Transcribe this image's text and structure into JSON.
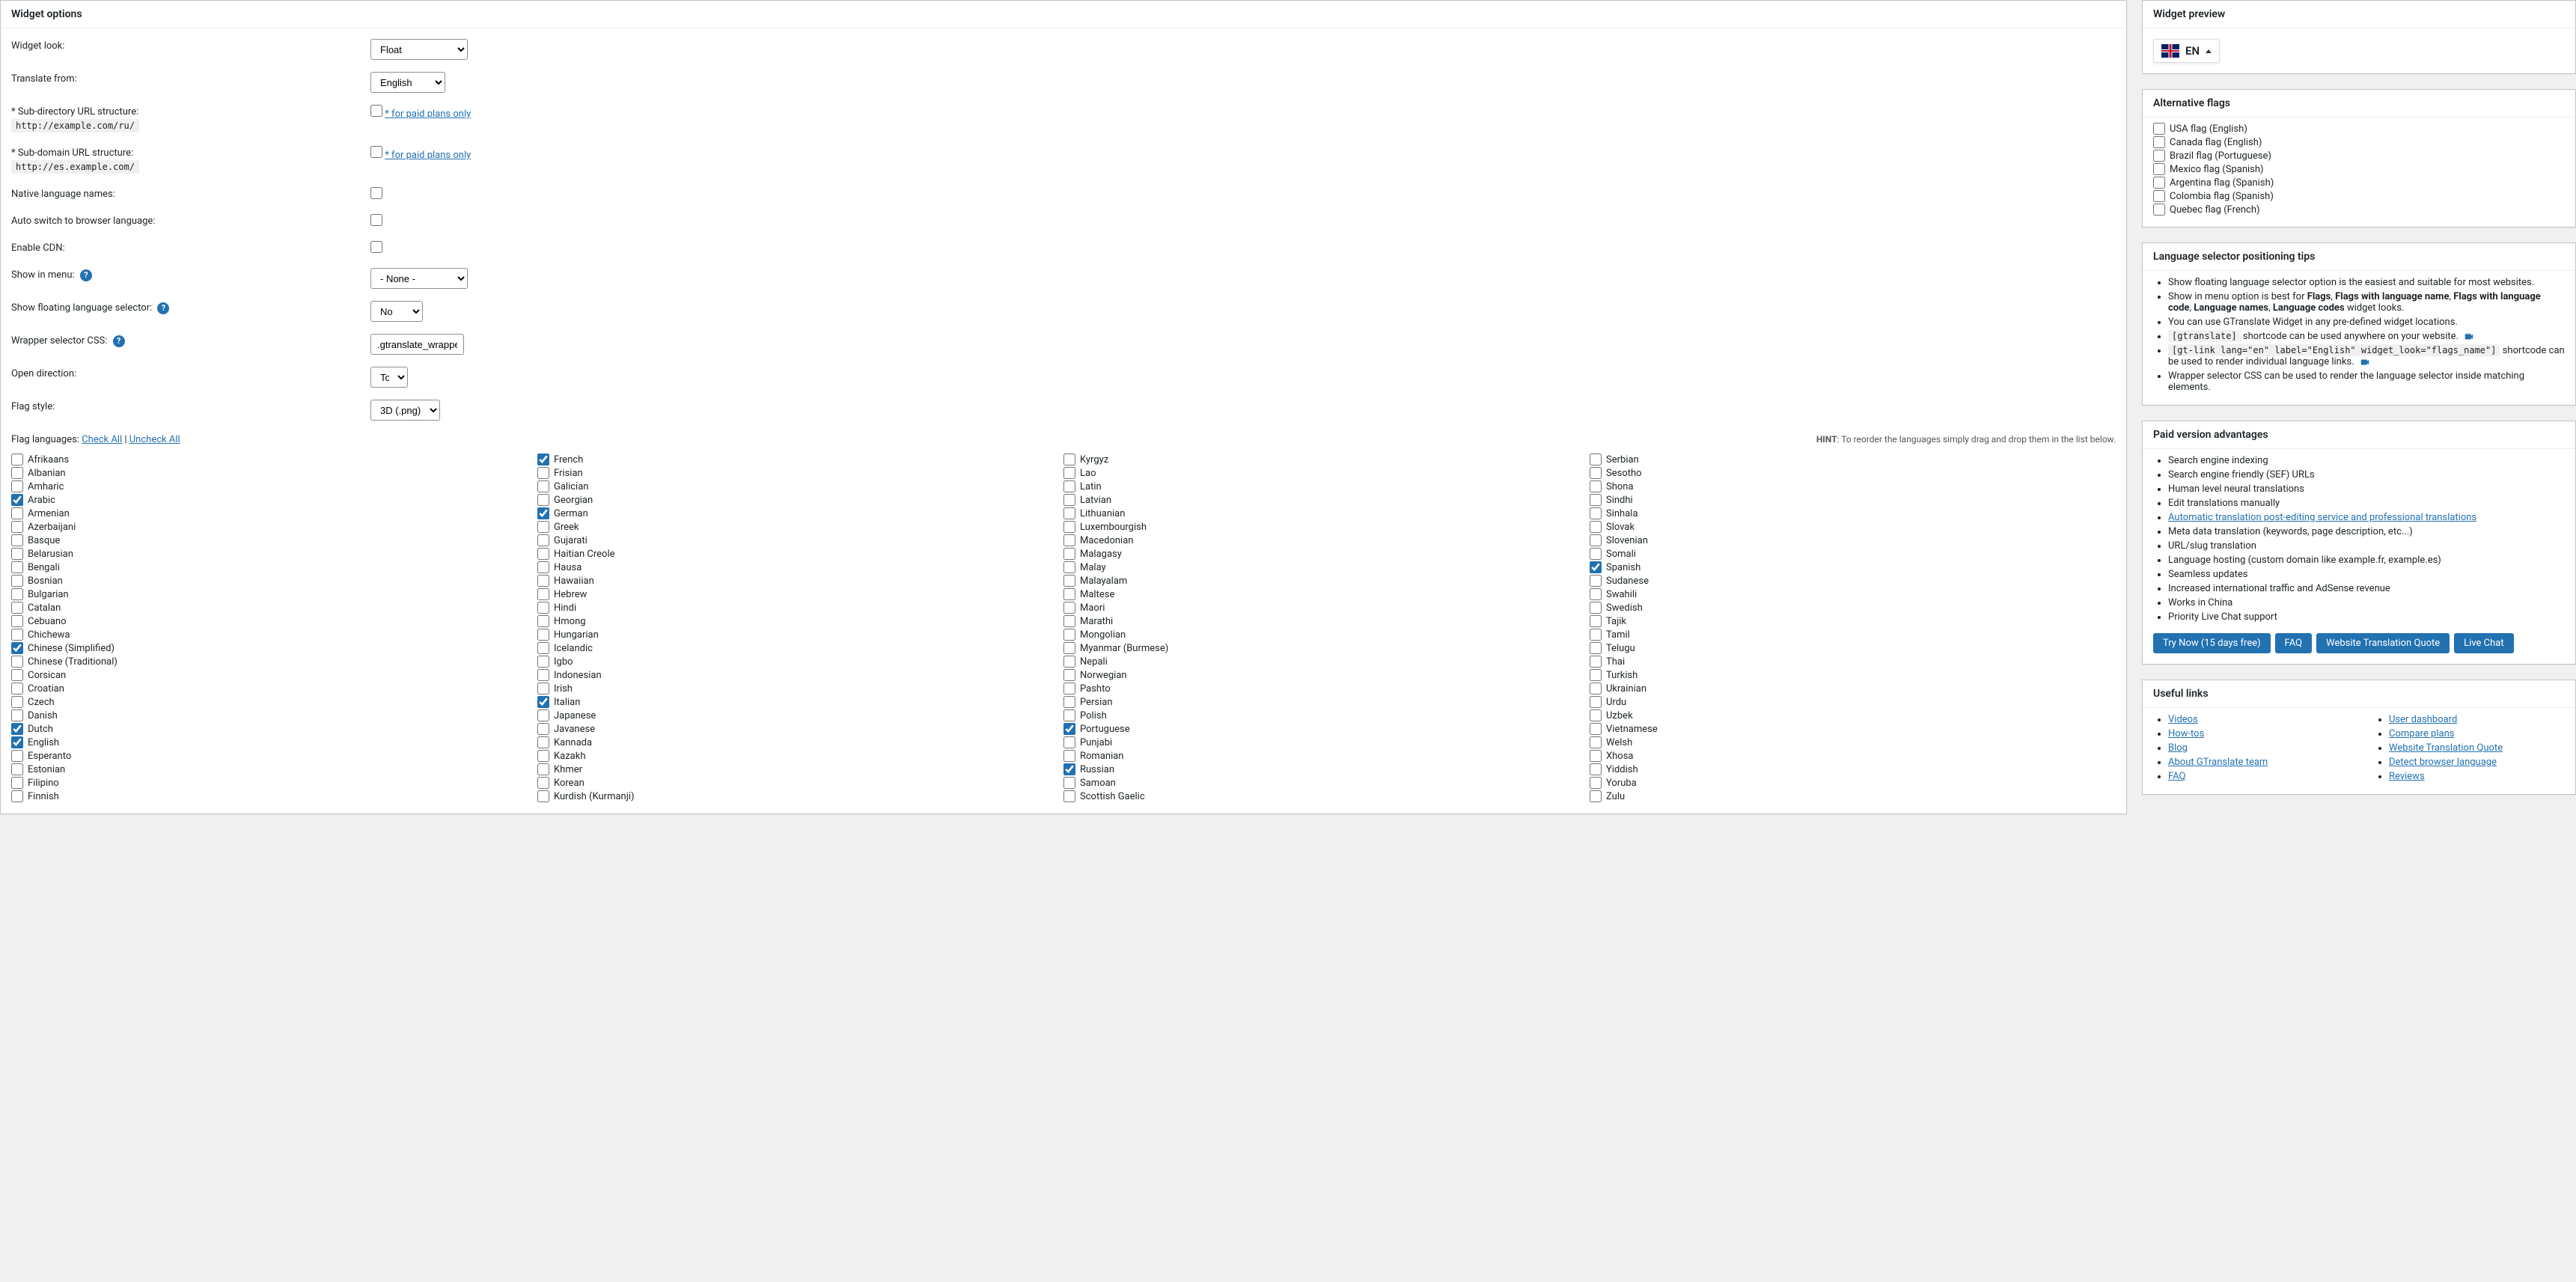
{
  "widgetOptions": {
    "title": "Widget options",
    "rows": {
      "widgetLook": {
        "label": "Widget look:",
        "value": "Float"
      },
      "translateFrom": {
        "label": "Translate from:",
        "value": "English"
      },
      "subDirUrl": {
        "label": "* Sub-directory URL structure:",
        "example": "http://example.com/ru/",
        "paidLink": "* for paid plans only"
      },
      "subDomainUrl": {
        "label": "* Sub-domain URL structure:",
        "example": "http://es.example.com/",
        "paidLink": "* for paid plans only"
      },
      "nativeNames": {
        "label": "Native language names:"
      },
      "autoSwitch": {
        "label": "Auto switch to browser language:"
      },
      "enableCdn": {
        "label": "Enable CDN:"
      },
      "showInMenu": {
        "label": "Show in menu:",
        "value": "- None -"
      },
      "showFloating": {
        "label": "Show floating language selector:",
        "value": "No"
      },
      "wrapperCss": {
        "label": "Wrapper selector CSS:",
        "value": ".gtranslate_wrapper"
      },
      "openDirection": {
        "label": "Open direction:",
        "value": "Top"
      },
      "flagStyle": {
        "label": "Flag style:",
        "value": "3D (.png)"
      }
    },
    "flagLanguagesLabel": "Flag languages:",
    "checkAll": "Check All",
    "uncheckAll": "Uncheck All",
    "hint": {
      "prefix": "HINT",
      "text": ": To reorder the languages simply drag and drop them in the list below."
    },
    "languages": [
      [
        {
          "name": "Afrikaans",
          "checked": false
        },
        {
          "name": "Albanian",
          "checked": false
        },
        {
          "name": "Amharic",
          "checked": false
        },
        {
          "name": "Arabic",
          "checked": true
        },
        {
          "name": "Armenian",
          "checked": false
        },
        {
          "name": "Azerbaijani",
          "checked": false
        },
        {
          "name": "Basque",
          "checked": false
        },
        {
          "name": "Belarusian",
          "checked": false
        },
        {
          "name": "Bengali",
          "checked": false
        },
        {
          "name": "Bosnian",
          "checked": false
        },
        {
          "name": "Bulgarian",
          "checked": false
        },
        {
          "name": "Catalan",
          "checked": false
        },
        {
          "name": "Cebuano",
          "checked": false
        },
        {
          "name": "Chichewa",
          "checked": false
        },
        {
          "name": "Chinese (Simplified)",
          "checked": true
        },
        {
          "name": "Chinese (Traditional)",
          "checked": false
        },
        {
          "name": "Corsican",
          "checked": false
        },
        {
          "name": "Croatian",
          "checked": false
        },
        {
          "name": "Czech",
          "checked": false
        },
        {
          "name": "Danish",
          "checked": false
        },
        {
          "name": "Dutch",
          "checked": true
        },
        {
          "name": "English",
          "checked": true
        },
        {
          "name": "Esperanto",
          "checked": false
        },
        {
          "name": "Estonian",
          "checked": false
        },
        {
          "name": "Filipino",
          "checked": false
        },
        {
          "name": "Finnish",
          "checked": false
        }
      ],
      [
        {
          "name": "French",
          "checked": true
        },
        {
          "name": "Frisian",
          "checked": false
        },
        {
          "name": "Galician",
          "checked": false
        },
        {
          "name": "Georgian",
          "checked": false
        },
        {
          "name": "German",
          "checked": true
        },
        {
          "name": "Greek",
          "checked": false
        },
        {
          "name": "Gujarati",
          "checked": false
        },
        {
          "name": "Haitian Creole",
          "checked": false
        },
        {
          "name": "Hausa",
          "checked": false
        },
        {
          "name": "Hawaiian",
          "checked": false
        },
        {
          "name": "Hebrew",
          "checked": false
        },
        {
          "name": "Hindi",
          "checked": false
        },
        {
          "name": "Hmong",
          "checked": false
        },
        {
          "name": "Hungarian",
          "checked": false
        },
        {
          "name": "Icelandic",
          "checked": false
        },
        {
          "name": "Igbo",
          "checked": false
        },
        {
          "name": "Indonesian",
          "checked": false
        },
        {
          "name": "Irish",
          "checked": false
        },
        {
          "name": "Italian",
          "checked": true
        },
        {
          "name": "Japanese",
          "checked": false
        },
        {
          "name": "Javanese",
          "checked": false
        },
        {
          "name": "Kannada",
          "checked": false
        },
        {
          "name": "Kazakh",
          "checked": false
        },
        {
          "name": "Khmer",
          "checked": false
        },
        {
          "name": "Korean",
          "checked": false
        },
        {
          "name": "Kurdish (Kurmanji)",
          "checked": false
        }
      ],
      [
        {
          "name": "Kyrgyz",
          "checked": false
        },
        {
          "name": "Lao",
          "checked": false
        },
        {
          "name": "Latin",
          "checked": false
        },
        {
          "name": "Latvian",
          "checked": false
        },
        {
          "name": "Lithuanian",
          "checked": false
        },
        {
          "name": "Luxembourgish",
          "checked": false
        },
        {
          "name": "Macedonian",
          "checked": false
        },
        {
          "name": "Malagasy",
          "checked": false
        },
        {
          "name": "Malay",
          "checked": false
        },
        {
          "name": "Malayalam",
          "checked": false
        },
        {
          "name": "Maltese",
          "checked": false
        },
        {
          "name": "Maori",
          "checked": false
        },
        {
          "name": "Marathi",
          "checked": false
        },
        {
          "name": "Mongolian",
          "checked": false
        },
        {
          "name": "Myanmar (Burmese)",
          "checked": false
        },
        {
          "name": "Nepali",
          "checked": false
        },
        {
          "name": "Norwegian",
          "checked": false
        },
        {
          "name": "Pashto",
          "checked": false
        },
        {
          "name": "Persian",
          "checked": false
        },
        {
          "name": "Polish",
          "checked": false
        },
        {
          "name": "Portuguese",
          "checked": true
        },
        {
          "name": "Punjabi",
          "checked": false
        },
        {
          "name": "Romanian",
          "checked": false
        },
        {
          "name": "Russian",
          "checked": true
        },
        {
          "name": "Samoan",
          "checked": false
        },
        {
          "name": "Scottish Gaelic",
          "checked": false
        }
      ],
      [
        {
          "name": "Serbian",
          "checked": false
        },
        {
          "name": "Sesotho",
          "checked": false
        },
        {
          "name": "Shona",
          "checked": false
        },
        {
          "name": "Sindhi",
          "checked": false
        },
        {
          "name": "Sinhala",
          "checked": false
        },
        {
          "name": "Slovak",
          "checked": false
        },
        {
          "name": "Slovenian",
          "checked": false
        },
        {
          "name": "Somali",
          "checked": false
        },
        {
          "name": "Spanish",
          "checked": true
        },
        {
          "name": "Sudanese",
          "checked": false
        },
        {
          "name": "Swahili",
          "checked": false
        },
        {
          "name": "Swedish",
          "checked": false
        },
        {
          "name": "Tajik",
          "checked": false
        },
        {
          "name": "Tamil",
          "checked": false
        },
        {
          "name": "Telugu",
          "checked": false
        },
        {
          "name": "Thai",
          "checked": false
        },
        {
          "name": "Turkish",
          "checked": false
        },
        {
          "name": "Ukrainian",
          "checked": false
        },
        {
          "name": "Urdu",
          "checked": false
        },
        {
          "name": "Uzbek",
          "checked": false
        },
        {
          "name": "Vietnamese",
          "checked": false
        },
        {
          "name": "Welsh",
          "checked": false
        },
        {
          "name": "Xhosa",
          "checked": false
        },
        {
          "name": "Yiddish",
          "checked": false
        },
        {
          "name": "Yoruba",
          "checked": false
        },
        {
          "name": "Zulu",
          "checked": false
        }
      ]
    ]
  },
  "widgetPreview": {
    "title": "Widget preview",
    "code": "EN"
  },
  "altFlags": {
    "title": "Alternative flags",
    "items": [
      "USA flag (English)",
      "Canada flag (English)",
      "Brazil flag (Portuguese)",
      "Mexico flag (Spanish)",
      "Argentina flag (Spanish)",
      "Colombia flag (Spanish)",
      "Quebec flag (French)"
    ]
  },
  "tips": {
    "title": "Language selector positioning tips",
    "li1": "Show floating language selector option is the easiest and suitable for most websites.",
    "li2_a": "Show in menu option is best for ",
    "li2_b": "Flags",
    "li2_c": ", ",
    "li2_d": "Flags with language name",
    "li2_e": ", ",
    "li2_f": "Flags with language code",
    "li2_g": ", ",
    "li2_h": "Language names",
    "li2_i": ", ",
    "li2_j": "Language codes",
    "li2_k": " widget looks.",
    "li3": "You can use GTranslate Widget in any pre-defined widget locations.",
    "li4_code": "[gtranslate]",
    "li4_text": " shortcode can be used anywhere on your website. ",
    "li5_code": "[gt-link lang=\"en\" label=\"English\" widget_look=\"flags_name\"]",
    "li5_text": " shortcode can be used to render individual language links. ",
    "li6": "Wrapper selector CSS can be used to render the language selector inside matching elements."
  },
  "paidAdv": {
    "title": "Paid version advantages",
    "items": [
      "Search engine indexing",
      "Search engine friendly (SEF) URLs",
      "Human level neural translations",
      "Edit translations manually"
    ],
    "linkItem": "Automatic translation post-editing service and professional translations",
    "items2": [
      "Meta data translation (keywords, page description, etc...)",
      "URL/slug translation",
      "Language hosting (custom domain like example.fr, example.es)",
      "Seamless updates",
      "Increased international traffic and AdSense revenue",
      "Works in China",
      "Priority Live Chat support"
    ],
    "buttons": [
      "Try Now (15 days free)",
      "FAQ",
      "Website Translation Quote",
      "Live Chat"
    ]
  },
  "useful": {
    "title": "Useful links",
    "col1": [
      "Videos",
      "How-tos",
      "Blog",
      "About GTranslate team",
      "FAQ"
    ],
    "col2": [
      "User dashboard",
      "Compare plans",
      "Website Translation Quote",
      "Detect browser language",
      "Reviews"
    ]
  }
}
